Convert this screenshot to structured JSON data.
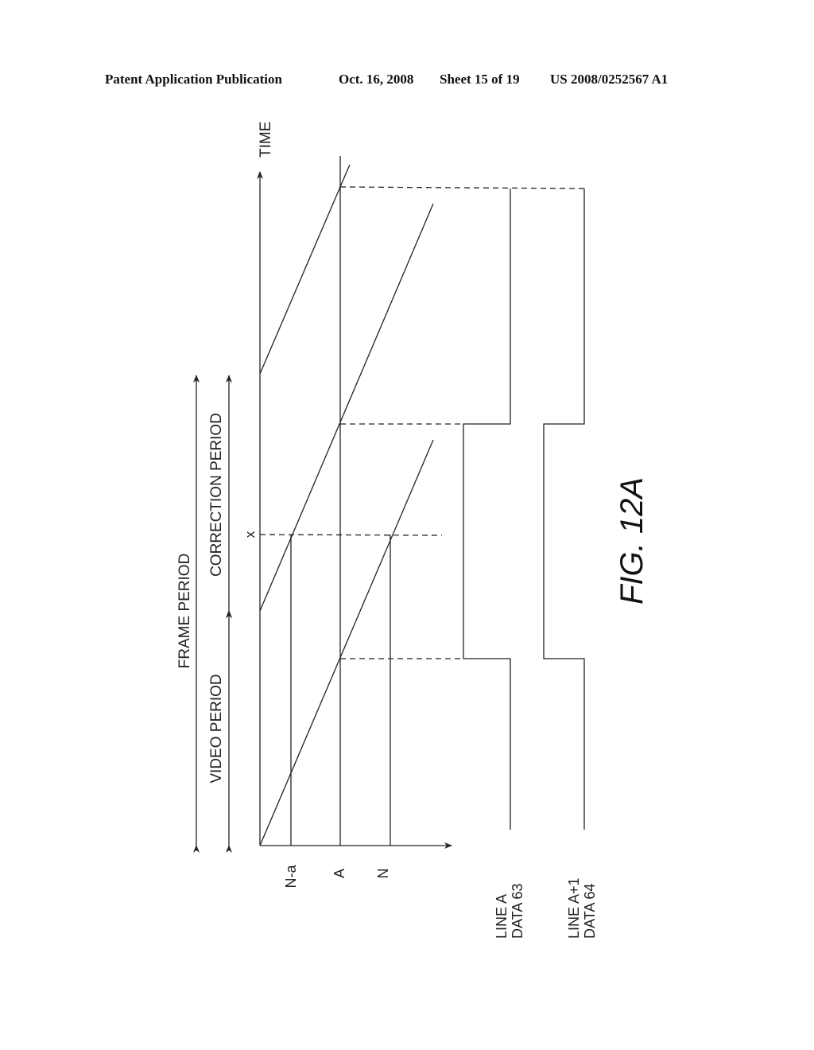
{
  "header": {
    "publication": "Patent Application Publication",
    "date": "Oct. 16, 2008",
    "sheet": "Sheet 15 of 19",
    "patent_number": "US 2008/0252567 A1"
  },
  "figure": {
    "caption": "FIG. 12A",
    "time_axis_label": "TIME",
    "x_marker_label": "x",
    "periods": {
      "frame": "FRAME PERIOD",
      "video": "VIDEO PERIOD",
      "correction": "CORRECTION PERIOD"
    },
    "line_axis_labels": [
      "N-a",
      "A",
      "N"
    ],
    "signals": [
      {
        "line_label": "LINE A",
        "data_label": "DATA 63"
      },
      {
        "line_label": "LINE A+1",
        "data_label": "DATA 64"
      }
    ],
    "colors": {
      "ink": "#222222",
      "background": "#ffffff"
    }
  }
}
